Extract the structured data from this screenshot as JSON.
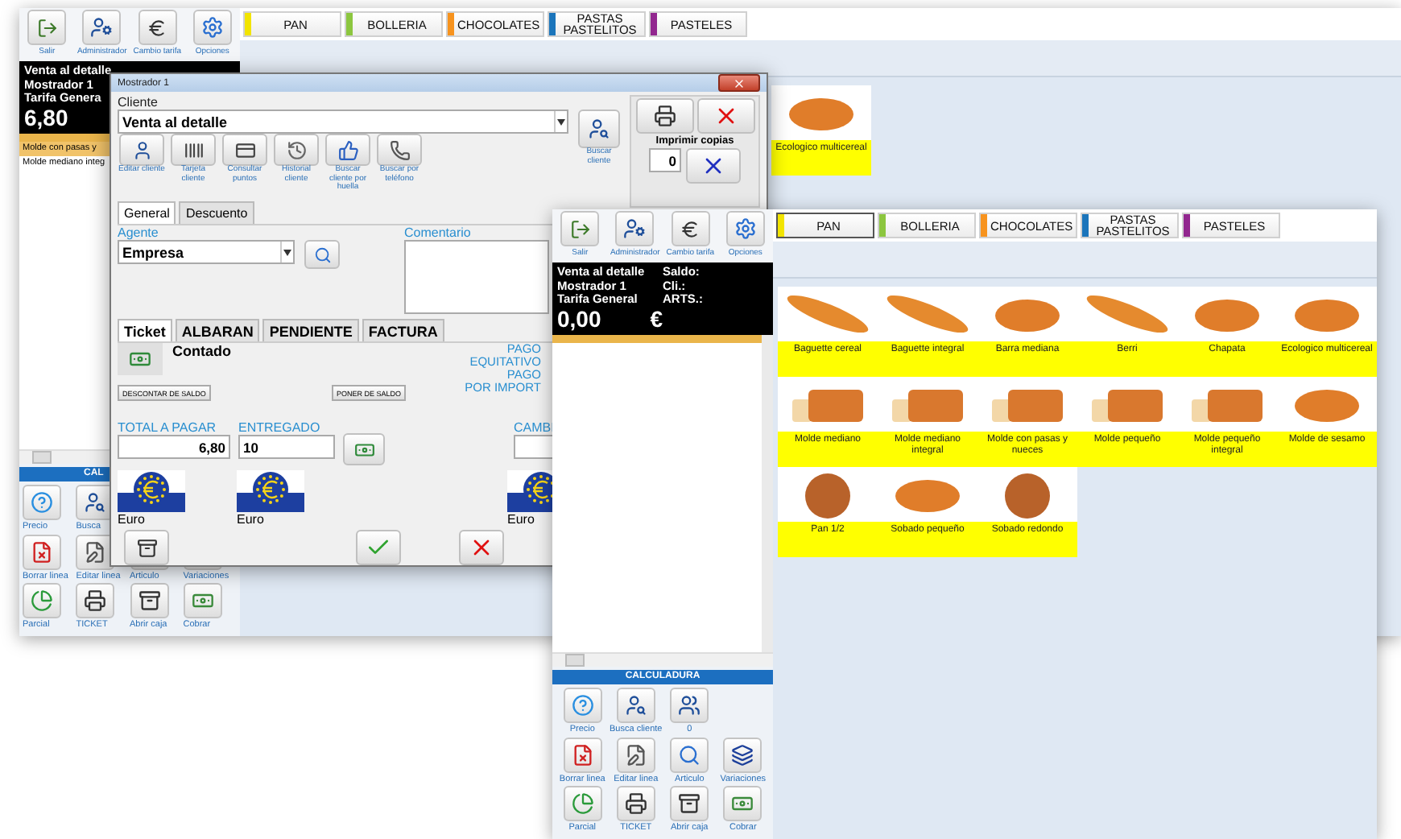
{
  "back_window": {
    "toolbar": [
      {
        "label": "Salir"
      },
      {
        "label": "Administrador"
      },
      {
        "label": "Cambio tarifa"
      },
      {
        "label": "Opciones"
      }
    ],
    "info": {
      "lines": [
        "Venta al detalle",
        "Mostrador 1",
        "Tarifa Genera"
      ],
      "total": "6,80"
    },
    "ticket_lines": [
      {
        "text": "Molde con pasas y",
        "selected": true
      },
      {
        "text": "Molde mediano integ",
        "selected": false
      }
    ],
    "calculator_title": "CAL",
    "calculator_rows": [
      [
        {
          "label": "Precio"
        },
        {
          "label": "Busca"
        }
      ],
      [
        {
          "label": "Borrar linea"
        },
        {
          "label": "Editar linea"
        },
        {
          "label": "Articulo"
        },
        {
          "label": "Variaciones"
        }
      ],
      [
        {
          "label": "Parcial"
        },
        {
          "label": "TICKET"
        },
        {
          "label": "Abrir caja"
        },
        {
          "label": "Cobrar"
        }
      ]
    ],
    "categories": [
      {
        "label": "PAN",
        "color": "#f2e400",
        "selected": false
      },
      {
        "label": "BOLLERIA",
        "color": "#8cc63f",
        "selected": false
      },
      {
        "label": "CHOCOLATES",
        "color": "#f7931e",
        "selected": false
      },
      {
        "label": "PASTAS PASTELITOS",
        "color": "#1b75bb",
        "selected": false
      },
      {
        "label": "PASTELES",
        "color": "#92278f",
        "selected": false
      }
    ],
    "products": [
      {
        "name": "Ecologico multicereal",
        "kind": "loaf"
      }
    ]
  },
  "dialog": {
    "title": "Mostrador 1",
    "client_label": "Cliente",
    "client_value": "Venta al detalle",
    "search_client": "Buscar cliente",
    "client_actions": [
      {
        "label": "Editar cliente"
      },
      {
        "label": "Tarjeta cliente"
      },
      {
        "label": "Consultar puntos"
      },
      {
        "label": "Historial cliente"
      },
      {
        "label": "Buscar cliente por huella"
      },
      {
        "label": "Buscar por teléfono"
      }
    ],
    "print_copies_label": "Imprimir copias",
    "print_copies": "0",
    "tabs": [
      {
        "label": "General",
        "selected": true
      },
      {
        "label": "Descuento",
        "selected": false
      }
    ],
    "agent_label": "Agente",
    "agent_value": "Empresa",
    "comment_label": "Comentario",
    "doc_tabs": [
      {
        "label": "Ticket",
        "selected": true
      },
      {
        "label": "ALBARAN",
        "selected": false
      },
      {
        "label": "PENDIENTE",
        "selected": false
      },
      {
        "label": "FACTURA",
        "selected": false
      }
    ],
    "payment_method": "Contado",
    "pay_options": [
      {
        "lines": [
          "PAGO",
          "EQUITATIVO"
        ]
      },
      {
        "lines": [
          "PAGO",
          "POR IMPORT"
        ]
      }
    ],
    "discount_button": "DESCONTAR DE SALDO",
    "add_balance_button": "PONER DE SALDO",
    "total_label": "TOTAL A PAGAR",
    "total": "6,80",
    "delivered_label": "ENTREGADO",
    "delivered": "10",
    "change_label": "CAMBI",
    "currencies": [
      "Euro",
      "Euro",
      "Euro"
    ]
  },
  "front_window": {
    "toolbar": [
      {
        "label": "Salir"
      },
      {
        "label": "Administrador"
      },
      {
        "label": "Cambio tarifa"
      },
      {
        "label": "Opciones"
      }
    ],
    "info": {
      "lines": [
        "Venta al detalle",
        "Mostrador 1",
        "Tarifa General"
      ],
      "total": "0,00",
      "currency": "€",
      "side": [
        "Saldo:",
        "Cli.:",
        "ARTS.:"
      ]
    },
    "calculator_title": "CALCULADURA",
    "calculator_rows": [
      [
        {
          "label": "Precio"
        },
        {
          "label": "Busca cliente"
        },
        {
          "label": "0"
        }
      ],
      [
        {
          "label": "Borrar linea"
        },
        {
          "label": "Editar linea"
        },
        {
          "label": "Articulo"
        },
        {
          "label": "Variaciones"
        }
      ],
      [
        {
          "label": "Parcial"
        },
        {
          "label": "TICKET"
        },
        {
          "label": "Abrir caja"
        },
        {
          "label": "Cobrar"
        }
      ]
    ],
    "categories": [
      {
        "label": "PAN",
        "color": "#f2e400",
        "selected": true
      },
      {
        "label": "BOLLERIA",
        "color": "#8cc63f",
        "selected": false
      },
      {
        "label": "CHOCOLATES",
        "color": "#f7931e",
        "selected": false
      },
      {
        "label": "PASTAS PASTELITOS",
        "color": "#1b75bb",
        "selected": false
      },
      {
        "label": "PASTELES",
        "color": "#92278f",
        "selected": false
      }
    ],
    "products": [
      {
        "name": "Baguette cereal",
        "kind": "baguette"
      },
      {
        "name": "Baguette integral",
        "kind": "baguette"
      },
      {
        "name": "Barra mediana",
        "kind": "loaf"
      },
      {
        "name": "Berri",
        "kind": "baguette"
      },
      {
        "name": "Chapata",
        "kind": "loaf"
      },
      {
        "name": "Ecologico multicereal",
        "kind": "loaf"
      },
      {
        "name": "Molde mediano",
        "kind": "sliced"
      },
      {
        "name": "Molde mediano integral",
        "kind": "sliced"
      },
      {
        "name": "Molde con pasas y nueces",
        "kind": "sliced"
      },
      {
        "name": "Molde pequeño",
        "kind": "sliced"
      },
      {
        "name": "Molde pequeño integral",
        "kind": "sliced"
      },
      {
        "name": "Molde de sesamo",
        "kind": "loaf"
      },
      {
        "name": "Pan 1/2",
        "kind": "round"
      },
      {
        "name": "Sobado pequeño",
        "kind": "loaf"
      },
      {
        "name": "Sobado redondo",
        "kind": "round"
      }
    ]
  }
}
